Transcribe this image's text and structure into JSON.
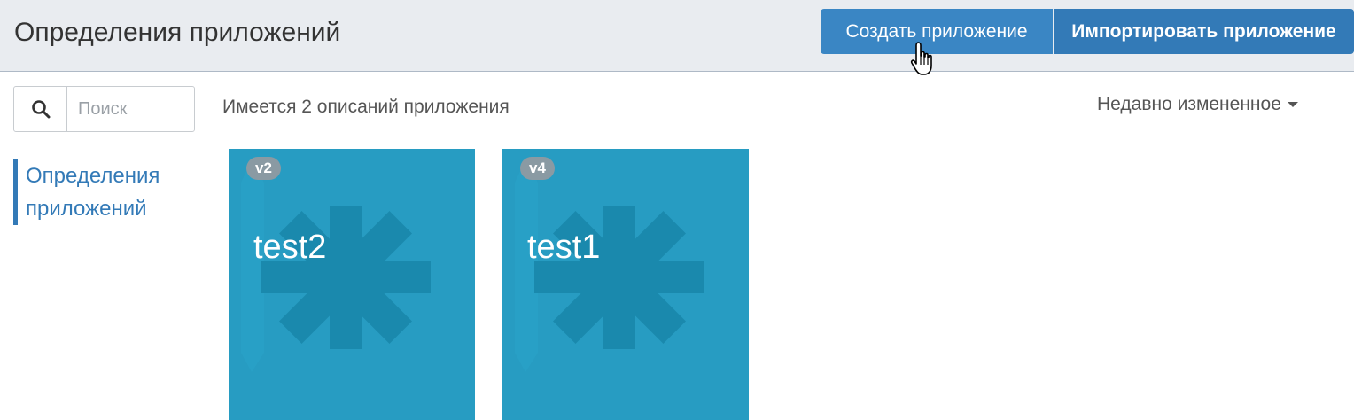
{
  "header": {
    "title": "Определения приложений",
    "create_button": "Создать приложение",
    "import_button": "Импортировать приложение"
  },
  "sidebar": {
    "search_placeholder": "Поиск",
    "search_icon": "search-icon",
    "items": [
      {
        "label": "Определения приложений",
        "active": true
      }
    ]
  },
  "main": {
    "count_text": "Имеется 2 описаний приложения",
    "sort_label": "Недавно измененное",
    "apps": [
      {
        "version": "v2",
        "name": "test2"
      },
      {
        "version": "v4",
        "name": "test1"
      }
    ]
  },
  "colors": {
    "accent": "#337ab7",
    "tile": "#279cc2",
    "tile_icon": "#1a89ad",
    "header_bg": "#e9ecf0",
    "badge": "#8a9aa3"
  }
}
